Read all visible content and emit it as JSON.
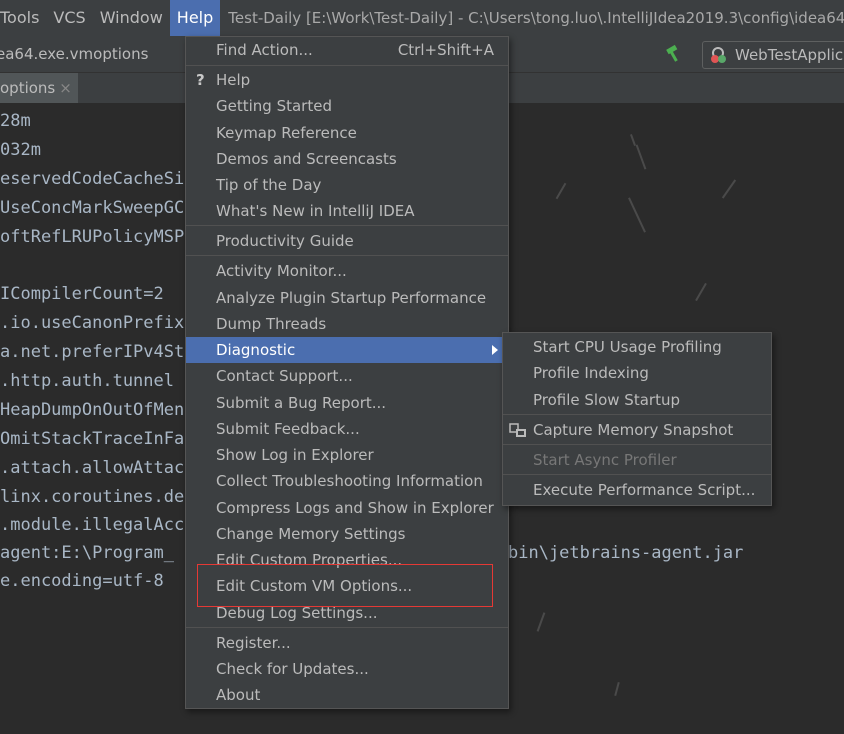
{
  "menubar": {
    "items": [
      "Tools",
      "VCS",
      "Window",
      "Help"
    ],
    "title": "Test-Daily [E:\\Work\\Test-Daily] - C:\\Users\\tong.luo\\.IntelliJIdea2019.3\\config\\idea64"
  },
  "navbar": {
    "file": "ea64.exe.vmoptions",
    "run_config": "WebTestApplic"
  },
  "tab": {
    "label": "options",
    "close": "×"
  },
  "editor": {
    "lines": [
      "28m",
      "032m",
      "eservedCodeCacheSi",
      "UseConcMarkSweepGC",
      "oftRefLRUPolicyMSP",
      "",
      "ICompilerCount=2",
      ".io.useCanonPrefix",
      "a.net.preferIPv4St",
      ".http.auth.tunnel",
      "HeapDumpOnOutOfMen",
      "OmitStackTraceInFa",
      ".attach.allowAttac",
      "linx.coroutines.de",
      ".module.illegalAcc",
      "agent:E:\\Program_",
      "e.encoding=utf-8"
    ],
    "agent_tail": "bin\\jetbrains-agent.jar"
  },
  "help_menu": {
    "find_action": {
      "label": "Find Action...",
      "shortcut": "Ctrl+Shift+A"
    },
    "help": "Help",
    "getting_started": "Getting Started",
    "keymap_reference": "Keymap Reference",
    "demos": "Demos and Screencasts",
    "tip_of_day": "Tip of the Day",
    "whats_new": "What's New in IntelliJ IDEA",
    "productivity_guide": "Productivity Guide",
    "activity_monitor": "Activity Monitor...",
    "analyze_plugin": "Analyze Plugin Startup Performance",
    "dump_threads": "Dump Threads",
    "diagnostic": "Diagnostic",
    "contact_support": "Contact Support...",
    "submit_bug": "Submit a Bug Report...",
    "submit_feedback": "Submit Feedback...",
    "show_log": "Show Log in Explorer",
    "collect_troubleshooting": "Collect Troubleshooting Information",
    "compress_logs": "Compress Logs and Show in Explorer",
    "change_memory": "Change Memory Settings",
    "edit_custom_properties": "Edit Custom Properties...",
    "edit_custom_vm": "Edit Custom VM Options...",
    "debug_log": "Debug Log Settings...",
    "register": "Register...",
    "check_updates": "Check for Updates...",
    "about": "About"
  },
  "diagnostic_menu": {
    "start_cpu": "Start CPU Usage Profiling",
    "profile_indexing": "Profile Indexing",
    "profile_slow_startup": "Profile Slow Startup",
    "capture_memory": "Capture Memory Snapshot",
    "start_async": "Start Async Profiler",
    "execute_perf": "Execute Performance Script..."
  },
  "colors": {
    "menu_bg": "#3c3f41",
    "selection": "#4b6eaf",
    "highlight_border": "#e53935",
    "editor_bg": "#2b2b2b"
  }
}
